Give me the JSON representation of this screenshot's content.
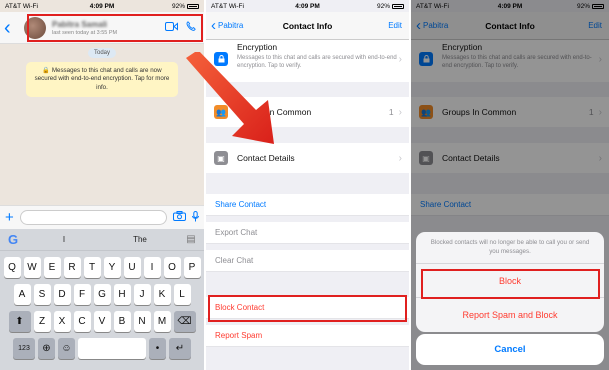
{
  "status": {
    "carrier": "AT&T Wi-Fi",
    "time": "4:09 PM",
    "battery": "92%"
  },
  "chat": {
    "contact_name": "Pabitra Samali",
    "last_seen": "last seen today at 3:55 PM",
    "day": "Today",
    "encryption_message": "🔒 Messages to this chat and calls are now secured with end-to-end encryption. Tap for more info.",
    "suggestions": [
      "I",
      "The"
    ],
    "keyboard_rows": [
      [
        "Q",
        "W",
        "E",
        "R",
        "T",
        "Y",
        "U",
        "I",
        "O",
        "P"
      ],
      [
        "A",
        "S",
        "D",
        "F",
        "G",
        "H",
        "J",
        "K",
        "L"
      ],
      [
        "Z",
        "X",
        "C",
        "V",
        "B",
        "N",
        "M"
      ]
    ],
    "num_key": "123"
  },
  "contact_info": {
    "back_label": "Pabitra",
    "title": "Contact Info",
    "edit_label": "Edit",
    "encryption_title": "Encryption",
    "encryption_desc": "Messages to this chat and calls are secured with end-to-end encryption. Tap to verify.",
    "groups_label": "Groups In Common",
    "groups_count": "1",
    "contact_details_label": "Contact Details",
    "actions": {
      "share": "Share Contact",
      "export": "Export Chat",
      "clear": "Clear Chat",
      "block": "Block Contact",
      "report": "Report Spam"
    }
  },
  "block_sheet": {
    "back_label": "Pabitra",
    "title": "Contact Info",
    "edit_label": "Edit",
    "encryption_title": "Encryption",
    "encryption_desc": "Messages to this chat and calls are secured with end-to-end encryption. Tap to verify.",
    "groups_label": "Groups In Common",
    "groups_count": "1",
    "contact_details_label": "Contact Details",
    "share_label": "Share Contact",
    "message": "Blocked contacts will no longer be able to call you or send you messages.",
    "block_label": "Block",
    "report_block_label": "Report Spam and Block",
    "cancel_label": "Cancel"
  },
  "colors": {
    "accent": "#007aff",
    "destructive": "#ff3b30",
    "highlight": "#e0201f",
    "chat_bg": "#ece5dd",
    "bubble": "#fff5c4"
  }
}
